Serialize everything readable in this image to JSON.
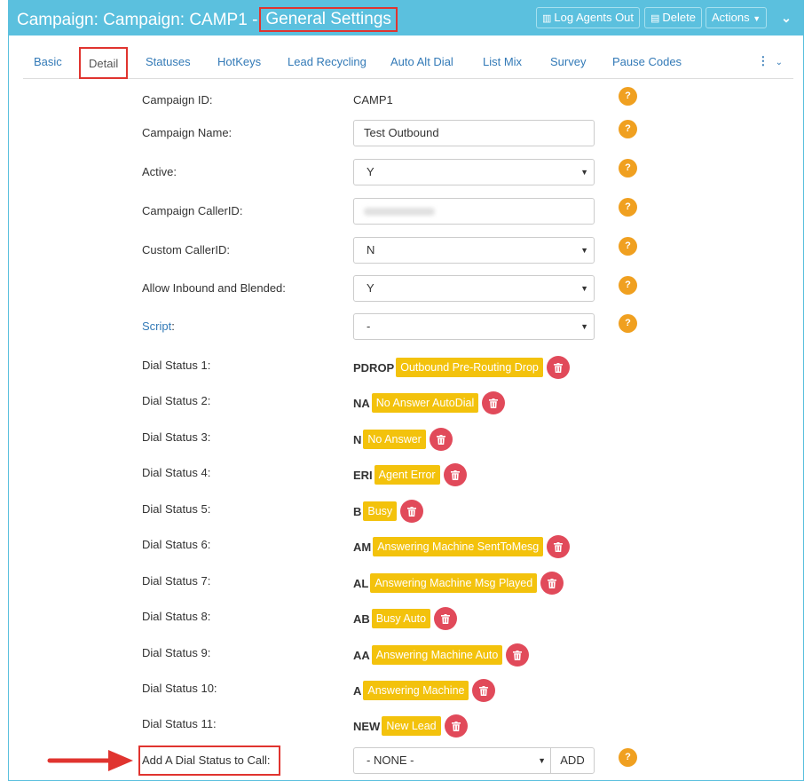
{
  "header": {
    "title_prefix": "Campaign: Campaign: CAMP1 -",
    "title_highlight": "General Settings",
    "log_agents_out": "Log Agents Out",
    "delete": "Delete",
    "actions": "Actions"
  },
  "tabs": [
    {
      "label": "Basic"
    },
    {
      "label": "Detail"
    },
    {
      "label": "Statuses"
    },
    {
      "label": "HotKeys"
    },
    {
      "label": "Lead Recycling"
    },
    {
      "label": "Auto Alt Dial"
    },
    {
      "label": "List Mix"
    },
    {
      "label": "Survey"
    },
    {
      "label": "Pause Codes"
    }
  ],
  "help_glyph": "?",
  "fields": {
    "campaign_id": {
      "label": "Campaign ID:",
      "value": "CAMP1"
    },
    "campaign_name": {
      "label": "Campaign Name:",
      "value": "Test Outbound"
    },
    "active": {
      "label": "Active:",
      "value": "Y"
    },
    "callerid": {
      "label": "Campaign CallerID:"
    },
    "custom_callerid": {
      "label": "Custom CallerID:",
      "value": "N"
    },
    "inbound_blended": {
      "label": "Allow Inbound and Blended:",
      "value": "Y"
    },
    "script": {
      "label": "Script",
      "colon": ":",
      "value": "-"
    }
  },
  "dial_statuses": [
    {
      "label": "Dial Status 1:",
      "code": "PDROP",
      "name": "Outbound Pre-Routing Drop"
    },
    {
      "label": "Dial Status 2:",
      "code": "NA",
      "name": "No Answer AutoDial"
    },
    {
      "label": "Dial Status 3:",
      "code": "N",
      "name": "No Answer"
    },
    {
      "label": "Dial Status 4:",
      "code": "ERI",
      "name": "Agent Error"
    },
    {
      "label": "Dial Status 5:",
      "code": "B",
      "name": "Busy"
    },
    {
      "label": "Dial Status 6:",
      "code": "AM",
      "name": "Answering Machine SentToMesg"
    },
    {
      "label": "Dial Status 7:",
      "code": "AL",
      "name": "Answering Machine Msg Played"
    },
    {
      "label": "Dial Status 8:",
      "code": "AB",
      "name": "Busy Auto"
    },
    {
      "label": "Dial Status 9:",
      "code": "AA",
      "name": "Answering Machine Auto"
    },
    {
      "label": "Dial Status 10:",
      "code": "A",
      "name": "Answering Machine"
    },
    {
      "label": "Dial Status 11:",
      "code": "NEW",
      "name": "New Lead"
    }
  ],
  "add_status": {
    "label": "Add A Dial Status to Call:",
    "selected": "- NONE -",
    "button": "ADD"
  },
  "colors": {
    "header_bg": "#5bc0de",
    "highlight": "#e0342f",
    "status_pill": "#f3c20c",
    "trash": "#e14a5a",
    "help": "#f0a020",
    "link": "#337ab7"
  }
}
